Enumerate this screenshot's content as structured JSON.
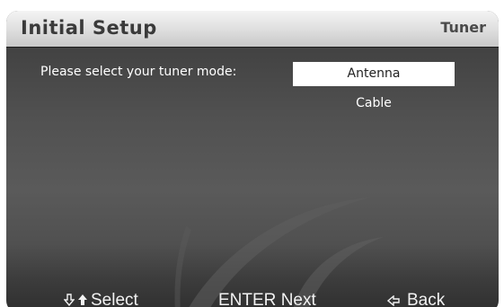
{
  "header": {
    "title": "Initial Setup",
    "section": "Tuner"
  },
  "main": {
    "prompt": "Please select your tuner mode:",
    "options": [
      {
        "label": "Antenna",
        "selected": true
      },
      {
        "label": "Cable",
        "selected": false
      }
    ]
  },
  "footer": {
    "select_label": "Select",
    "next_key": "ENTER",
    "next_label": "Next",
    "back_label": "Back"
  },
  "icons": {
    "down": "arrow-down-icon",
    "up": "arrow-up-icon",
    "left": "arrow-left-icon"
  },
  "colors": {
    "title_bar": "#dcdcdc",
    "title_text": "#3a3a3a",
    "panel_bg": "#4d4d4d",
    "selected_bg": "#ffffff",
    "text": "#ffffff"
  }
}
